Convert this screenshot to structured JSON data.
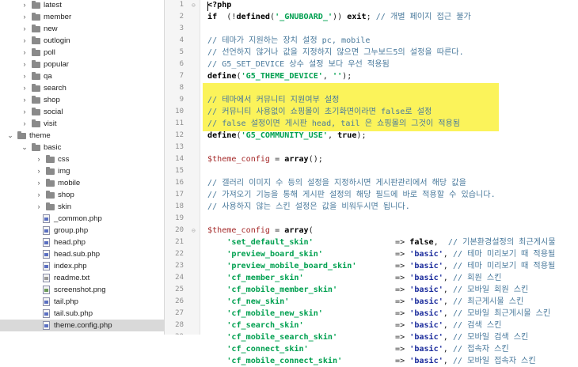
{
  "tree": [
    {
      "label": "latest",
      "type": "folder",
      "level": 2,
      "expanded": false
    },
    {
      "label": "member",
      "type": "folder",
      "level": 2,
      "expanded": false
    },
    {
      "label": "new",
      "type": "folder",
      "level": 2,
      "expanded": false
    },
    {
      "label": "outlogin",
      "type": "folder",
      "level": 2,
      "expanded": false
    },
    {
      "label": "poll",
      "type": "folder",
      "level": 2,
      "expanded": false
    },
    {
      "label": "popular",
      "type": "folder",
      "level": 2,
      "expanded": false
    },
    {
      "label": "qa",
      "type": "folder",
      "level": 2,
      "expanded": false
    },
    {
      "label": "search",
      "type": "folder",
      "level": 2,
      "expanded": false
    },
    {
      "label": "shop",
      "type": "folder",
      "level": 2,
      "expanded": false
    },
    {
      "label": "social",
      "type": "folder",
      "level": 2,
      "expanded": false
    },
    {
      "label": "visit",
      "type": "folder",
      "level": 2,
      "expanded": false
    },
    {
      "label": "theme",
      "type": "folder",
      "level": 1,
      "expanded": true
    },
    {
      "label": "basic",
      "type": "folder",
      "level": 2,
      "expanded": true
    },
    {
      "label": "css",
      "type": "folder",
      "level": 3,
      "expanded": false
    },
    {
      "label": "img",
      "type": "folder",
      "level": 3,
      "expanded": false
    },
    {
      "label": "mobile",
      "type": "folder",
      "level": 3,
      "expanded": false
    },
    {
      "label": "shop",
      "type": "folder",
      "level": 3,
      "expanded": false
    },
    {
      "label": "skin",
      "type": "folder",
      "level": 3,
      "expanded": false
    },
    {
      "label": "_common.php",
      "type": "file",
      "level": 3
    },
    {
      "label": "group.php",
      "type": "file",
      "level": 3
    },
    {
      "label": "head.php",
      "type": "file",
      "level": 3
    },
    {
      "label": "head.sub.php",
      "type": "file",
      "level": 3
    },
    {
      "label": "index.php",
      "type": "file",
      "level": 3
    },
    {
      "label": "readme.txt",
      "type": "txt",
      "level": 3
    },
    {
      "label": "screenshot.png",
      "type": "img",
      "level": 3
    },
    {
      "label": "tail.php",
      "type": "file",
      "level": 3
    },
    {
      "label": "tail.sub.php",
      "type": "file",
      "level": 3
    },
    {
      "label": "theme.config.php",
      "type": "file",
      "level": 3,
      "selected": true
    }
  ],
  "editor": {
    "highlight_color": "#fbf35a",
    "lines": [
      {
        "n": "1",
        "segs": [
          [
            "kw",
            "<?php"
          ]
        ]
      },
      {
        "n": "2",
        "segs": [
          [
            "kw",
            "if"
          ],
          [
            "",
            "  (!"
          ],
          [
            "kw",
            "defined"
          ],
          [
            "",
            "("
          ],
          [
            "str",
            "'_GNUBOARD_'"
          ],
          [
            "",
            "))"
          ],
          [
            "kw",
            " exit"
          ],
          [
            "",
            "; "
          ],
          [
            "cm",
            "// 개별 페이지 접근 불가"
          ]
        ]
      },
      {
        "n": "3",
        "segs": []
      },
      {
        "n": "4",
        "segs": [
          [
            "cm",
            "// 테마가 지원하는 장치 설정 pc, mobile"
          ]
        ]
      },
      {
        "n": "5",
        "segs": [
          [
            "cm",
            "// 선언하지 않거나 값을 지정하지 않으면 그누보드5의 설정을 따른다."
          ]
        ]
      },
      {
        "n": "6",
        "segs": [
          [
            "cm",
            "// G5_SET_DEVICE 상수 설정 보다 우선 적용됨"
          ]
        ]
      },
      {
        "n": "7",
        "segs": [
          [
            "kw",
            "define"
          ],
          [
            "",
            "("
          ],
          [
            "str",
            "'G5_THEME_DEVICE'"
          ],
          [
            "",
            ", "
          ],
          [
            "str",
            "''"
          ],
          [
            "",
            ");"
          ]
        ]
      },
      {
        "n": "8",
        "segs": []
      },
      {
        "n": "9",
        "segs": [
          [
            "cm",
            "// 테마에서 커뮤니티 지원여부 설정"
          ]
        ]
      },
      {
        "n": "10",
        "segs": [
          [
            "cm",
            "// 커뮤니티 사용없이 쇼핑몰이 초기화면이라면 false로 설정"
          ]
        ]
      },
      {
        "n": "11",
        "segs": [
          [
            "cm",
            "// false 설정이면 게시판 head, tail 은 쇼핑몰의 그것이 적용됨"
          ]
        ]
      },
      {
        "n": "12",
        "segs": [
          [
            "kw",
            "define"
          ],
          [
            "",
            "("
          ],
          [
            "str",
            "'G5_COMMUNITY_USE'"
          ],
          [
            "",
            ", "
          ],
          [
            "kw",
            "true"
          ],
          [
            "",
            ");"
          ]
        ]
      },
      {
        "n": "13",
        "segs": []
      },
      {
        "n": "14",
        "segs": [
          [
            "var",
            "$theme_config"
          ],
          [
            "",
            " = "
          ],
          [
            "kw",
            "array"
          ],
          [
            "",
            "();"
          ]
        ]
      },
      {
        "n": "15",
        "segs": []
      },
      {
        "n": "16",
        "segs": [
          [
            "cm",
            "// 갤러리 이미지 수 등의 설정을 지정하시면 게시판관리에서 해당 값을"
          ]
        ]
      },
      {
        "n": "17",
        "segs": [
          [
            "cm",
            "// 가져오기 기능을 통해 게시판 설정의 해당 필드에 바로 적용할 수 있습니다."
          ]
        ]
      },
      {
        "n": "18",
        "segs": [
          [
            "cm",
            "// 사용하지 않는 스킨 설정은 값을 비워두시면 됩니다."
          ]
        ]
      },
      {
        "n": "19",
        "segs": []
      },
      {
        "n": "20",
        "segs": [
          [
            "var",
            "$theme_config"
          ],
          [
            "",
            " = "
          ],
          [
            "kw",
            "array"
          ],
          [
            "",
            "("
          ]
        ]
      },
      {
        "n": "21",
        "segs": [
          [
            "",
            "    "
          ],
          [
            "str",
            "'set_default_skin'"
          ],
          [
            "",
            "                 => "
          ],
          [
            "kw",
            "false"
          ],
          [
            "",
            ",  "
          ],
          [
            "cm",
            "// 기본환경설정의 최근게시물"
          ]
        ]
      },
      {
        "n": "22",
        "segs": [
          [
            "",
            "    "
          ],
          [
            "str",
            "'preview_board_skin'"
          ],
          [
            "",
            "               => "
          ],
          [
            "bl",
            "'basic'"
          ],
          [
            "",
            ", "
          ],
          [
            "cm",
            "// 테마 미리보기 때 적용될"
          ]
        ]
      },
      {
        "n": "23",
        "segs": [
          [
            "",
            "    "
          ],
          [
            "str",
            "'preview_mobile_board_skin'"
          ],
          [
            "",
            "        => "
          ],
          [
            "bl",
            "'basic'"
          ],
          [
            "",
            ", "
          ],
          [
            "cm",
            "// 테마 미리보기 때 적용될"
          ]
        ]
      },
      {
        "n": "24",
        "segs": [
          [
            "",
            "    "
          ],
          [
            "str",
            "'cf_member_skin'"
          ],
          [
            "",
            "                   => "
          ],
          [
            "bl",
            "'basic'"
          ],
          [
            "",
            ", "
          ],
          [
            "cm",
            "// 회원 스킨"
          ]
        ]
      },
      {
        "n": "25",
        "segs": [
          [
            "",
            "    "
          ],
          [
            "str",
            "'cf_mobile_member_skin'"
          ],
          [
            "",
            "            => "
          ],
          [
            "bl",
            "'basic'"
          ],
          [
            "",
            ", "
          ],
          [
            "cm",
            "// 모바일 회원 스킨"
          ]
        ]
      },
      {
        "n": "26",
        "segs": [
          [
            "",
            "    "
          ],
          [
            "str",
            "'cf_new_skin'"
          ],
          [
            "",
            "                      => "
          ],
          [
            "bl",
            "'basic'"
          ],
          [
            "",
            ", "
          ],
          [
            "cm",
            "// 최근게시물 스킨"
          ]
        ]
      },
      {
        "n": "27",
        "segs": [
          [
            "",
            "    "
          ],
          [
            "str",
            "'cf_mobile_new_skin'"
          ],
          [
            "",
            "               => "
          ],
          [
            "bl",
            "'basic'"
          ],
          [
            "",
            ", "
          ],
          [
            "cm",
            "// 모바일 최근게시물 스킨"
          ]
        ]
      },
      {
        "n": "28",
        "segs": [
          [
            "",
            "    "
          ],
          [
            "str",
            "'cf_search_skin'"
          ],
          [
            "",
            "                   => "
          ],
          [
            "bl",
            "'basic'"
          ],
          [
            "",
            ", "
          ],
          [
            "cm",
            "// 검색 스킨"
          ]
        ]
      },
      {
        "n": "29",
        "segs": [
          [
            "",
            "    "
          ],
          [
            "str",
            "'cf_mobile_search_skin'"
          ],
          [
            "",
            "            => "
          ],
          [
            "bl",
            "'basic'"
          ],
          [
            "",
            ", "
          ],
          [
            "cm",
            "// 모바일 검색 스킨"
          ]
        ]
      },
      {
        "n": "30",
        "segs": [
          [
            "",
            "    "
          ],
          [
            "str",
            "'cf_connect_skin'"
          ],
          [
            "",
            "                  => "
          ],
          [
            "bl",
            "'basic'"
          ],
          [
            "",
            ", "
          ],
          [
            "cm",
            "// 접속자 스킨"
          ]
        ]
      },
      {
        "n": "31",
        "segs": [
          [
            "",
            "    "
          ],
          [
            "str",
            "'cf_mobile_connect_skin'"
          ],
          [
            "",
            "           => "
          ],
          [
            "bl",
            "'basic'"
          ],
          [
            "",
            ", "
          ],
          [
            "cm",
            "// 모바일 접속자 스킨"
          ]
        ]
      }
    ]
  }
}
